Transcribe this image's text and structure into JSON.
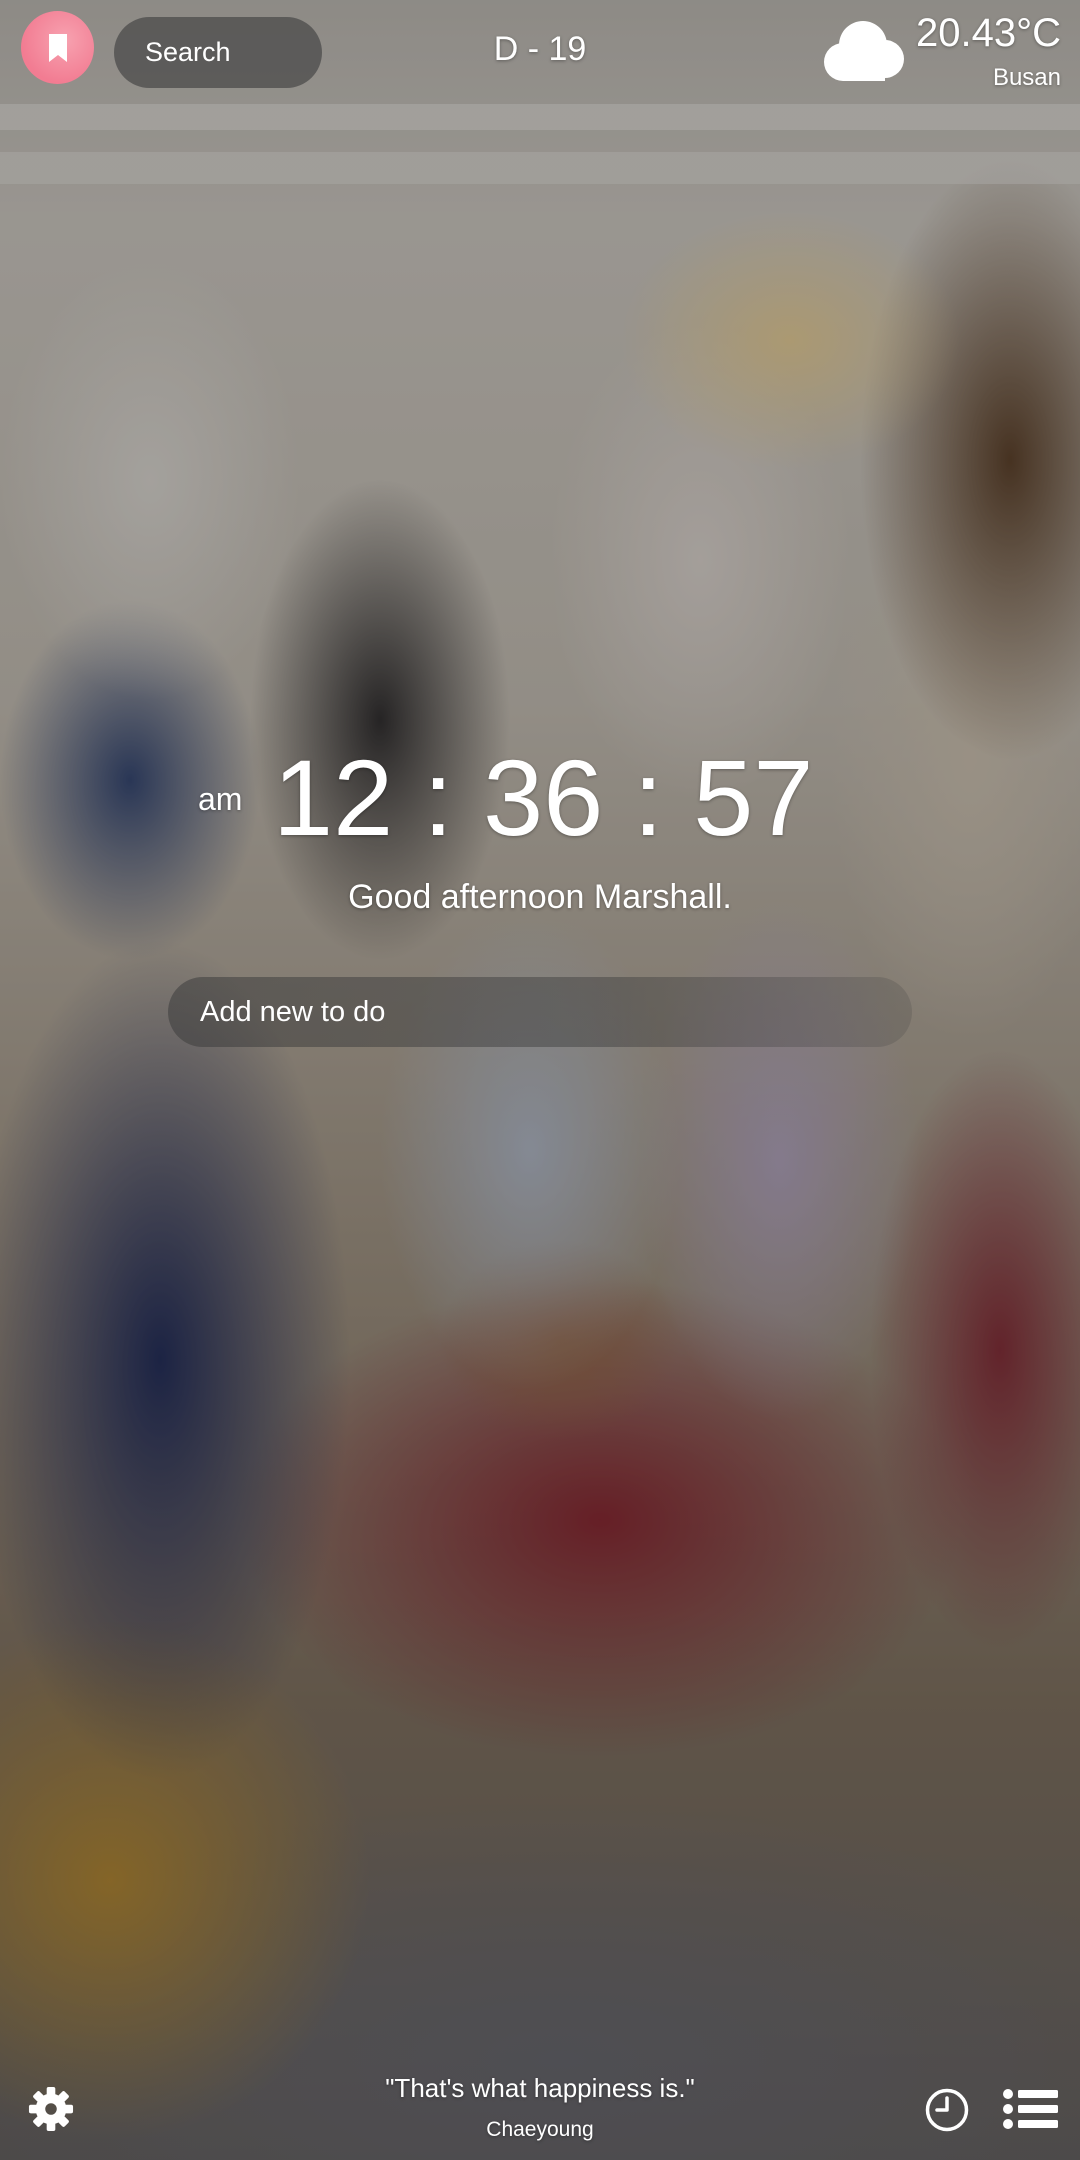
{
  "top_bar": {
    "bookmark_icon": "bookmark-icon",
    "bookmark_color": "#f27c92",
    "search_placeholder": "Search",
    "dday": "D - 19",
    "weather": {
      "icon": "cloud-icon",
      "temperature": "20.43°C",
      "city": "Busan"
    }
  },
  "clock": {
    "meridiem": "am",
    "time": "12 : 36 : 57"
  },
  "greeting": "Good afternoon Marshall.",
  "todo": {
    "placeholder": "Add new to do"
  },
  "quote": {
    "text": "\"That's what happiness is.\"",
    "author": "Chaeyoung"
  },
  "bottom_bar": {
    "settings_icon": "gear-icon",
    "history_icon": "clock-icon",
    "list_icon": "list-icon"
  }
}
